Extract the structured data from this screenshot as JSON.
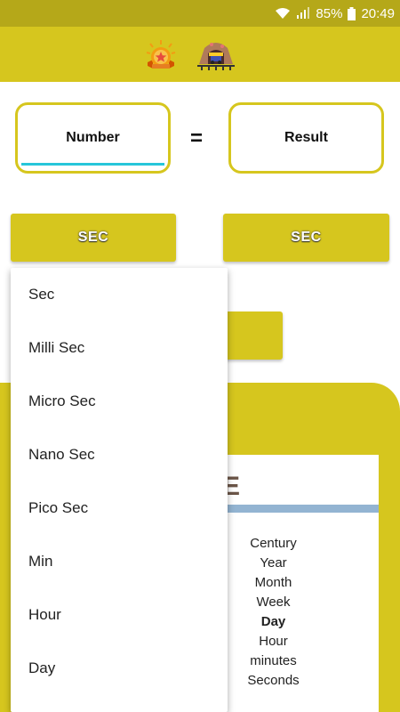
{
  "status_bar": {
    "battery": "85%",
    "time": "20:49"
  },
  "app_bar": {
    "icons": [
      "badge-star-icon",
      "mine-cart-icon"
    ]
  },
  "converter": {
    "input_placeholder": "Number",
    "equals": "=",
    "result_label": "Result",
    "from_unit": "SEC",
    "to_unit": "SEC"
  },
  "dropdown": {
    "options": [
      "Sec",
      "Milli Sec",
      "Micro Sec",
      "Nano Sec",
      "Pico Sec",
      "Min",
      "Hour",
      "Day"
    ]
  },
  "scale": {
    "partial_heading": "E",
    "items": [
      "Century",
      "Year",
      "Month",
      "Week",
      "Day",
      "Hour",
      "minutes",
      "Seconds"
    ],
    "highlighted": "Day"
  },
  "colors": {
    "status_bar": "#b5a819",
    "accent": "#d6c61e",
    "input_underline": "#26c6da",
    "scale_stripe": "#93b4d2"
  }
}
